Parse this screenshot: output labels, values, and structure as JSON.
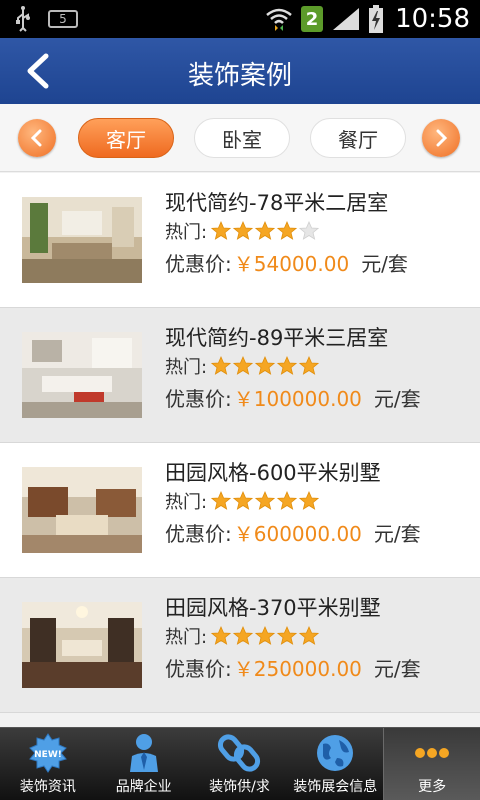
{
  "status_bar": {
    "sim_label": "5",
    "notification_count": "2",
    "time": "10:58"
  },
  "header": {
    "title": "装饰案例",
    "back_icon": "chevron-left-icon"
  },
  "tabs": {
    "prev_icon": "chevron-left-icon",
    "next_icon": "chevron-right-icon",
    "items": [
      {
        "label": "客厅",
        "active": true
      },
      {
        "label": "卧室",
        "active": false
      },
      {
        "label": "餐厅",
        "active": false
      }
    ]
  },
  "cases": [
    {
      "title": "现代简约-78平米二居室",
      "hot_label": "热门:",
      "rating": 4,
      "price_label": "优惠价:",
      "price": "￥54000.00",
      "unit": "元/套"
    },
    {
      "title": "现代简约-89平米三居室",
      "hot_label": "热门:",
      "rating": 5,
      "price_label": "优惠价:",
      "price": "￥100000.00",
      "unit": "元/套"
    },
    {
      "title": "田园风格-600平米别墅",
      "hot_label": "热门:",
      "rating": 5,
      "price_label": "优惠价:",
      "price": "￥600000.00",
      "unit": "元/套"
    },
    {
      "title": "田园风格-370平米别墅",
      "hot_label": "热门:",
      "rating": 5,
      "price_label": "优惠价:",
      "price": "￥250000.00",
      "unit": "元/套"
    }
  ],
  "bottom_nav": [
    {
      "label": "装饰资讯",
      "icon": "new-badge-icon",
      "badge": "NEW!"
    },
    {
      "label": "品牌企业",
      "icon": "businessman-icon"
    },
    {
      "label": "装饰供/求",
      "icon": "chain-link-icon"
    },
    {
      "label": "装饰展会信息",
      "icon": "globe-icon"
    },
    {
      "label": "更多",
      "icon": "more-dots-icon",
      "active": true
    }
  ],
  "colors": {
    "header_blue": "#2a51a0",
    "accent_orange": "#ef6f24",
    "price_orange": "#f08a1a",
    "star_gold": "#f5a623"
  }
}
